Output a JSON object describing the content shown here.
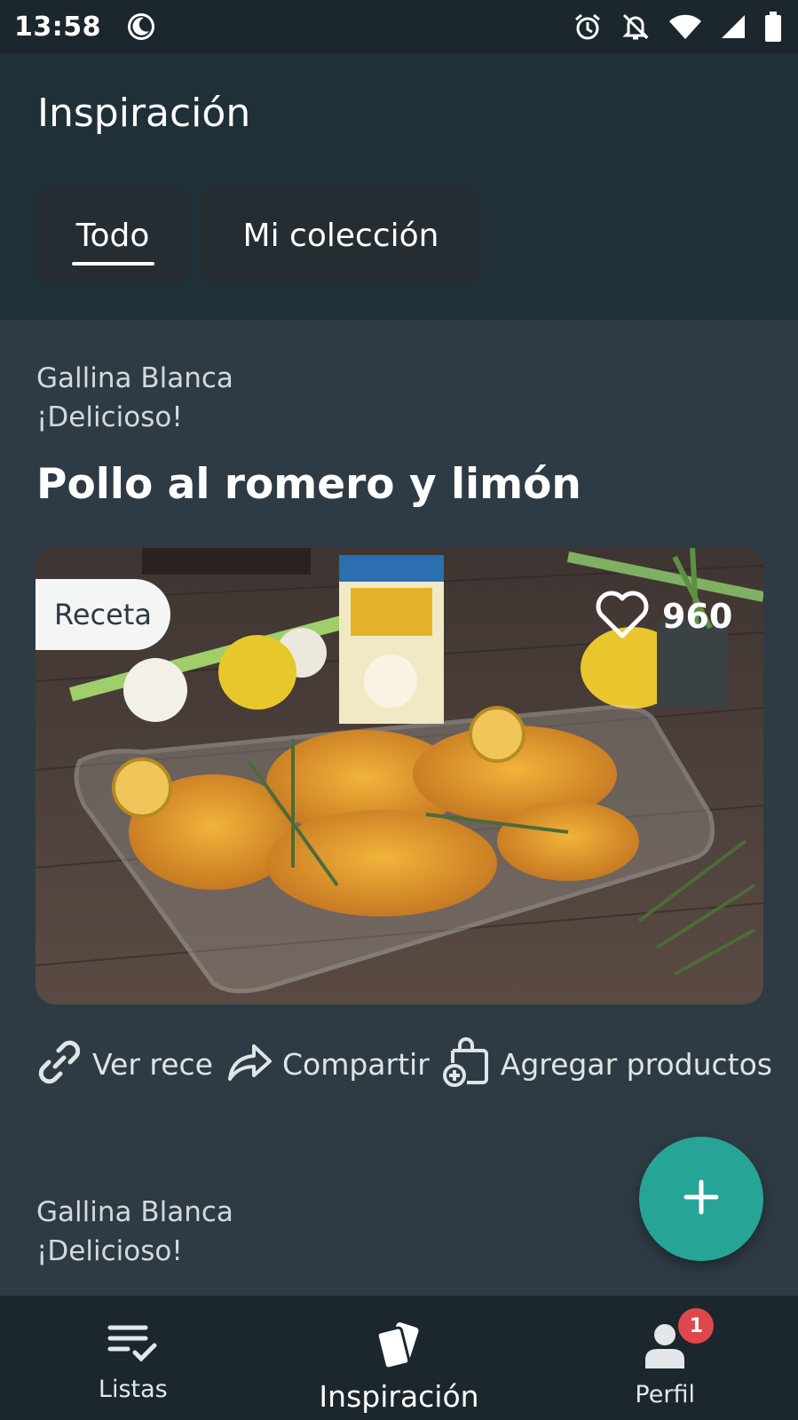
{
  "status_bar": {
    "time": "13:58",
    "icons": [
      "moon-icon",
      "alarm-icon",
      "notifications-off-icon",
      "wifi-icon",
      "signal-icon",
      "battery-icon"
    ]
  },
  "header": {
    "title": "Inspiración",
    "tabs": [
      {
        "label": "Todo",
        "selected": true
      },
      {
        "label": "Mi colección",
        "selected": false
      }
    ]
  },
  "feed": {
    "items": [
      {
        "brand": "Gallina Blanca",
        "tagline": "¡Delicioso!",
        "title": "Pollo al romero y limón",
        "badge": "Receta",
        "likes": "960",
        "actions": [
          {
            "icon": "link-icon",
            "label": "Ver rece"
          },
          {
            "icon": "share-icon",
            "label": "Compartir"
          },
          {
            "icon": "add-to-bag-icon",
            "label": "Agregar productos"
          }
        ]
      },
      {
        "brand": "Gallina Blanca",
        "tagline": "¡Delicioso!"
      }
    ]
  },
  "fab": {
    "icon": "plus-icon"
  },
  "bottom_nav": {
    "items": [
      {
        "label": "Listas",
        "icon": "list-check-icon",
        "active": false
      },
      {
        "label": "Inspiración",
        "icon": "cards-icon",
        "active": true
      },
      {
        "label": "Perfil",
        "icon": "person-icon",
        "active": false,
        "badge": "1"
      }
    ]
  },
  "colors": {
    "accent": "#26a596",
    "header_bg": "#203038",
    "content_bg": "#2e3b44",
    "nav_bg": "#1c262d",
    "badge_red": "#e0474c"
  }
}
